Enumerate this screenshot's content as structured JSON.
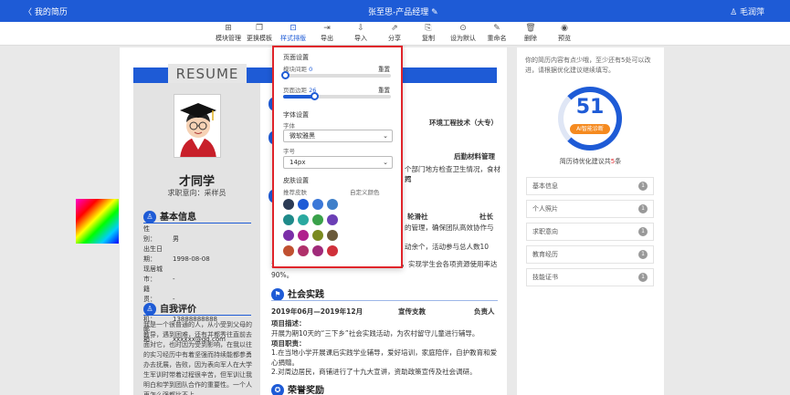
{
  "topbar": {
    "back": "〈 我的简历",
    "title": "张至思-产品经理 ✎",
    "user": "♙ 毛润萍"
  },
  "toolbar": {
    "items": [
      {
        "label": "模块管理",
        "icon": "⊞"
      },
      {
        "label": "更换模板",
        "icon": "❐"
      },
      {
        "label": "样式排版",
        "icon": "⊡"
      },
      {
        "label": "导出",
        "icon": "⇥"
      },
      {
        "label": "导入",
        "icon": "⇩"
      },
      {
        "label": "分享",
        "icon": "⇗"
      },
      {
        "label": "复制",
        "icon": "⎘"
      },
      {
        "label": "设为默认",
        "icon": "⊙"
      },
      {
        "label": "重命名",
        "icon": "✎"
      },
      {
        "label": "删除",
        "icon": "🗑"
      },
      {
        "label": "预览",
        "icon": "◉"
      }
    ]
  },
  "resume": {
    "title": "RESUME",
    "name": "才同学",
    "intent": "求职意向：采样员",
    "basic": {
      "heading": "基本信息",
      "rows": [
        {
          "k": "性　　别：",
          "v": "男"
        },
        {
          "k": "出生日期：",
          "v": "1998-08-08"
        },
        {
          "k": "现居城市：",
          "v": "-"
        },
        {
          "k": "籍　　贯：",
          "v": "-"
        },
        {
          "k": "手　　机：",
          "v": "13888888888"
        },
        {
          "k": "邮　　箱：",
          "v": "xxxxxx@qq.com"
        }
      ]
    },
    "self": {
      "heading": "自我评价",
      "text": "我是一个很普通的人，从小受到父母的教导，遇到困难，还有并都秀往直前去面对它，也时因为受到影响，在我以往的实习经历中有着坚强而持续能都参勇办去抚展，告败，因为表向军人在大学生军训时带着过程很辛苦，但军训让我明白和学到团队合作的重要性。一个人再怎么强都比不上"
    },
    "edu": {
      "school": "环境工程技术（大专）"
    },
    "work1": {
      "role": "后勤材料管理",
      "text1": "个部门地方检查卫生情况，食材挥",
      "text2": "鸡"
    },
    "work2": {
      "org": "轮滑社",
      "role": "社长",
      "text1": "的管理，确保团队高效协作与",
      "text2": "动余个，活动参与总人数10",
      "text3": "资源协调：需进并支持各部门资源使用要求，实现学生会各项资源使用率达90%。"
    },
    "practice": {
      "heading": "社会实践",
      "period": "2019年06月—2019年12月",
      "org": "宣传支教",
      "role": "负责人",
      "desc_title": "项目描述：",
      "desc": "开展为期10天的“三下乡”社会实践活动，为农村留守儿童进行辅导。",
      "duty_title": "项目职责：",
      "duty1": "1.在当地小学开展课后实践学业辅导，爱好培训，家庭陪伴，自护教育和爱心捐赠。",
      "duty2": "2.对周边居民，商铺进行了十九大宣讲，资助政策宣传及社会调研。"
    },
    "honor": {
      "heading": "荣誉奖励"
    }
  },
  "panel": {
    "page_settings": "页面设置",
    "module_spacing_label": "模块间距",
    "module_spacing_value": "0",
    "page_margin_label": "页面边距",
    "page_margin_value": "26",
    "reset": "重置",
    "font_settings": "字体设置",
    "font_label": "字体",
    "font_value": "微软雅黑",
    "size_label": "字号",
    "size_value": "14px",
    "skin_settings": "皮肤设置",
    "recommended": "推荐皮肤",
    "custom": "自定义颜色",
    "module_spacing_pct": 0,
    "page_margin_pct": 0.29,
    "swatches": [
      "#2b3a55",
      "#1e5bd6",
      "#3b78d8",
      "#3f7fc9",
      "#1f8a8a",
      "#2aa9a0",
      "#3aa14a",
      "#6b3fb5",
      "#7b2fa8",
      "#b0208c",
      "#7a8a1f",
      "#6a5a3a",
      "#c05030",
      "#b0306a",
      "#a02a7a",
      "#d0303a"
    ]
  },
  "sidebar": {
    "tip": "你的简历内容有点少哦，至少还有5处可以改进，请根据优化建议继续填写。",
    "score": "51",
    "diag": "AI智能诊断",
    "sugg_pre": "简历待优化建议共",
    "sugg_num": "5",
    "sugg_post": "条",
    "items": [
      {
        "label": "基本信息",
        "n": "1"
      },
      {
        "label": "个人照片",
        "n": "1"
      },
      {
        "label": "求职意向",
        "n": "1"
      },
      {
        "label": "教育经历",
        "n": "1"
      },
      {
        "label": "技能证书",
        "n": "1"
      }
    ]
  }
}
